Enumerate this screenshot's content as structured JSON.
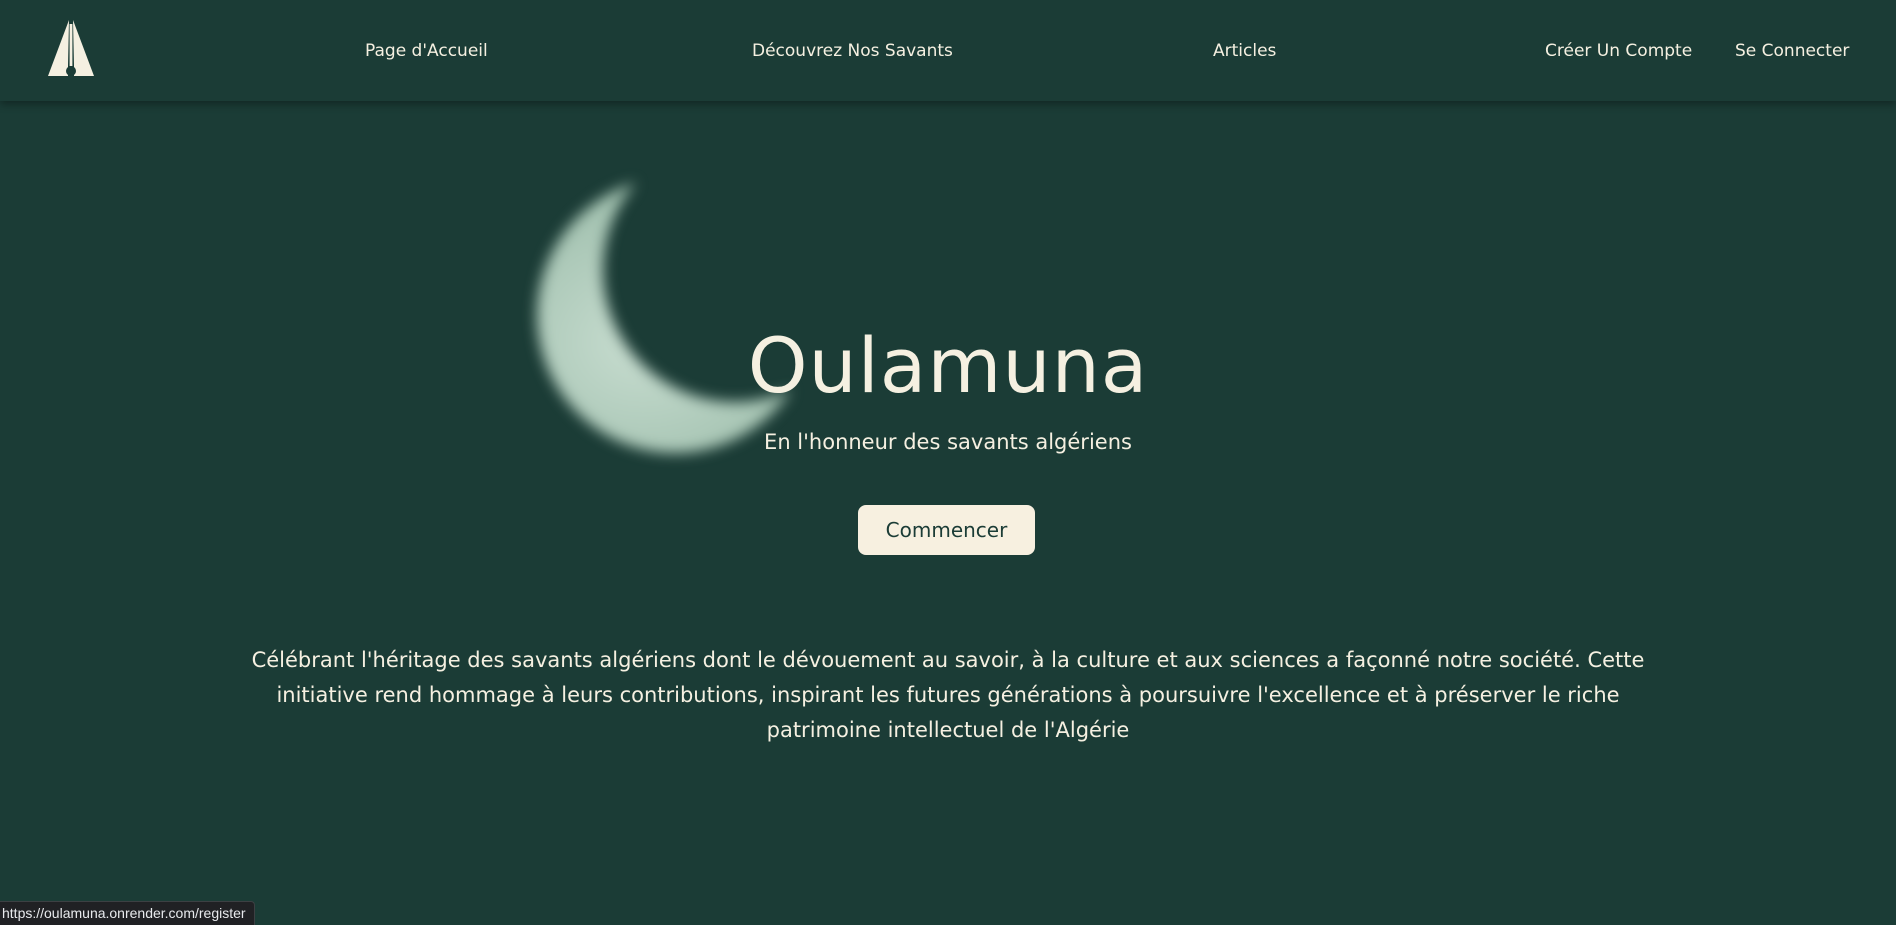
{
  "nav": {
    "logo_icon": "pen-nib-icon",
    "links": [
      {
        "label": "Page d'Accueil"
      },
      {
        "label": "Découvrez Nos Savants"
      },
      {
        "label": "Articles"
      },
      {
        "label": "Créer Un Compte"
      },
      {
        "label": "Se Connecter"
      }
    ]
  },
  "hero": {
    "decoration": "crescent-moon",
    "title": "Oulamuna",
    "subtitle": "En l'honneur des savants algériens",
    "cta_label": "Commencer"
  },
  "description": "Célébrant l'héritage des savants algériens dont le dévouement au savoir, à la culture et aux sciences a façonné notre société. Cette initiative rend hommage à leurs contributions, inspirant les futures générations à poursuivre l'excellence et à préserver le riche patrimoine intellectuel de l'Algérie",
  "status_bar": {
    "url": "https://oulamuna.onrender.com/register"
  },
  "colors": {
    "background": "#1b3c36",
    "text": "#f5f0e1",
    "button_bg": "#f7f0e0",
    "moon": "#b9d3c2"
  }
}
